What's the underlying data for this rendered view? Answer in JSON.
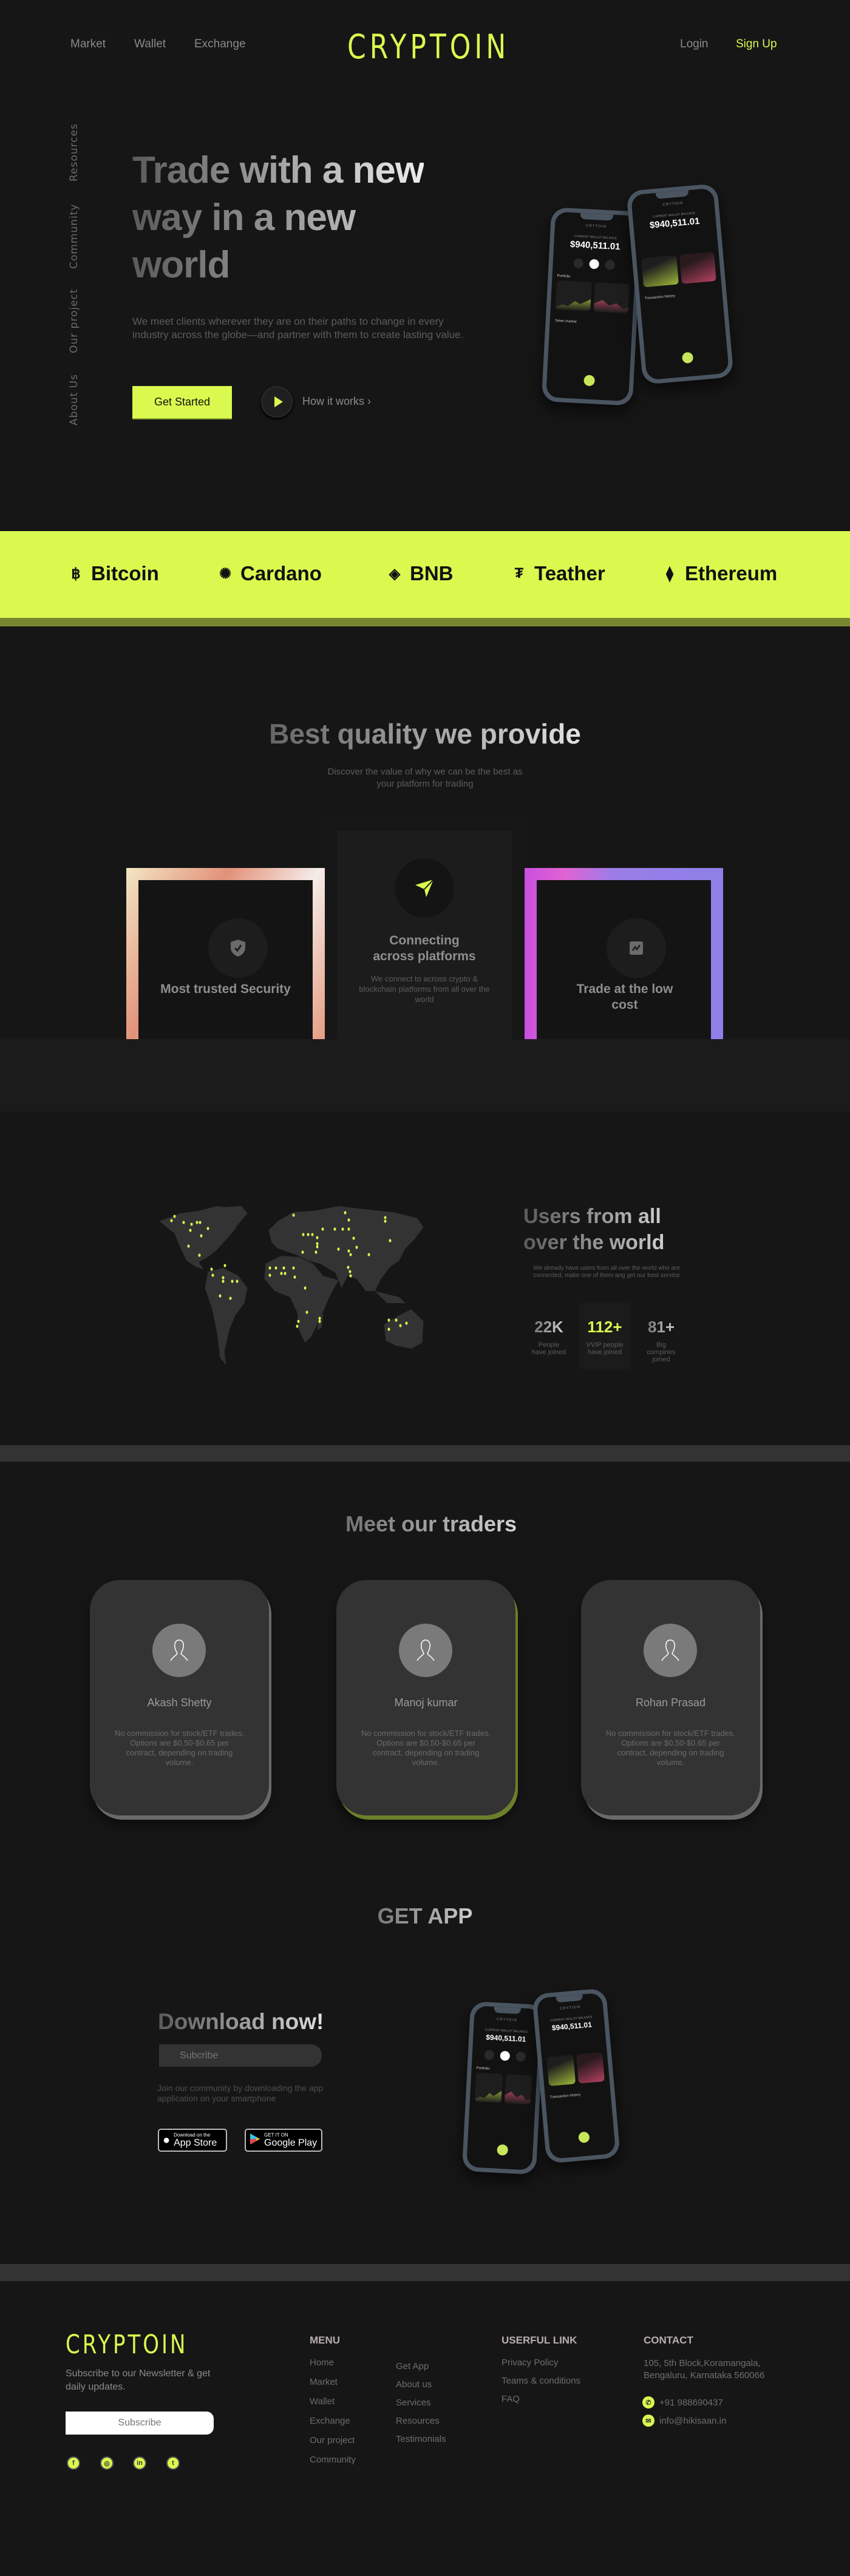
{
  "colors": {
    "accent": "#d9f94f",
    "background": "#161616",
    "band_shadow": "#76882f"
  },
  "header": {
    "nav_left": [
      "Market",
      "Wallet",
      "Exchange"
    ],
    "logo": "CRYPTOIN",
    "login": "Login",
    "signup": "Sign Up"
  },
  "side_nav": [
    "Resources",
    "Community",
    "Our project",
    "About Us"
  ],
  "hero": {
    "title_lines": [
      "Trade with a new",
      "way in a new",
      "world"
    ],
    "description": "We meet clients wherever they are on their paths to change in every industry across the globe—and partner with them to create lasting value.",
    "cta": "Get Started",
    "play_icon": "play-icon",
    "secondary": "How it works ›"
  },
  "phone": {
    "brand": "CRYTOIN",
    "balance_caption": "CURRENT WALLET BALANCE",
    "balance": "$940,511.01",
    "portfolio": "Portfolio",
    "token_market": "Token market",
    "history": "Transaction history"
  },
  "coins": [
    {
      "name": "Bitcoin",
      "icon": "bitcoin-icon",
      "glyph": "฿"
    },
    {
      "name": "Cardano",
      "icon": "cardano-icon",
      "glyph": "✺"
    },
    {
      "name": "BNB",
      "icon": "bnb-icon",
      "glyph": "◈"
    },
    {
      "name": "Teather",
      "icon": "tether-icon",
      "glyph": "₮"
    },
    {
      "name": "Ethereum",
      "icon": "ethereum-icon",
      "glyph": "⧫"
    }
  ],
  "quality": {
    "title": "Best quality we provide",
    "subtitle": "Discover the value of why we can be the best as your platform for trading",
    "cards": [
      {
        "title": "Most trusted Security",
        "icon": "shield-check-icon"
      },
      {
        "title": "Connecting across platforms",
        "icon": "paper-plane-icon",
        "description": "We connect to across crypto & blockchain platforms from all over the world"
      },
      {
        "title": "Trade at the low cost",
        "icon": "chart-icon"
      }
    ]
  },
  "users": {
    "title_lines": [
      "Users from all",
      "over the world"
    ],
    "subtitle": "We already have users from all over the world who are connected, make one of them ang get our best service",
    "stats": [
      {
        "value": "22K",
        "label": "People have joined"
      },
      {
        "value": "112+",
        "label": "VVIP people have joined"
      },
      {
        "value": "81+",
        "label": "Big compines joined"
      }
    ]
  },
  "traders": {
    "title": "Meet our traders",
    "items": [
      {
        "name": "Akash Shetty",
        "description": "No commission for stock/ETF trades. Options are $0.50-$0.65 per contract, depending on trading volume."
      },
      {
        "name": "Manoj kumar",
        "description": "No commission for stock/ETF trades. Options are $0.50-$0.65 per contract, depending on trading volume."
      },
      {
        "name": "Rohan Prasad",
        "description": "No commission for stock/ETF trades. Options are $0.50-$0.65 per contract, depending on trading volume."
      }
    ]
  },
  "get_app": {
    "title": "GET APP",
    "heading": "Download now!",
    "subscribe_placeholder": "Subcribe",
    "description": "Join our community by downloading the app application on your smartphone",
    "app_store": {
      "small": "Download on the",
      "big": "App Store"
    },
    "google_play": {
      "small": "GET IT ON",
      "big": "Google Play"
    }
  },
  "footer": {
    "logo": "CRYPTOIN",
    "newsletter": "Subscribe to our Newsletter & get daily updates.",
    "subscribe_placeholder": "Subscribe",
    "social": [
      "facebook-icon",
      "instagram-icon",
      "linkedin-icon",
      "twitter-icon"
    ],
    "menu_title": "MENU",
    "menu_col1": [
      "Home",
      "Market",
      "Wallet",
      "Exchange",
      "Our project",
      "Community"
    ],
    "menu_col2": [
      "Get App",
      "About us",
      "Services",
      "Resources",
      "Testimonials"
    ],
    "links_title": "USERFUL LINK",
    "links": [
      "Privacy Policy",
      "Teams & conditions",
      "FAQ"
    ],
    "contact_title": "CONTACT",
    "address": "105, 5th Block,Koramangala, Bengaluru, Karnataka 560066",
    "phone": "+91 988690437",
    "email": "info@hikisaan.in"
  }
}
